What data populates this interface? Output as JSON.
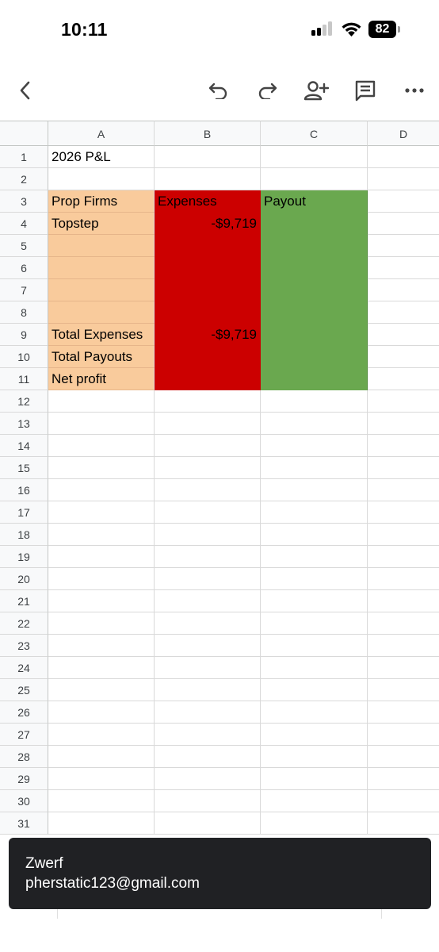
{
  "status_bar": {
    "time": "10:11",
    "battery": "82",
    "icons": [
      "cellular-signal-icon",
      "wifi-icon",
      "battery-icon"
    ]
  },
  "toolbar": {
    "icons": [
      "back-chevron-icon",
      "undo-icon",
      "redo-icon",
      "add-person-icon",
      "comment-icon",
      "more-icon"
    ]
  },
  "sheet": {
    "columns": [
      "A",
      "B",
      "C",
      "D"
    ],
    "rows": [
      {
        "n": "1",
        "a": "2026 P&L",
        "b": "",
        "c": ""
      },
      {
        "n": "2",
        "a": "",
        "b": "",
        "c": ""
      },
      {
        "n": "3",
        "a": "Prop Firms",
        "b": "Expenses",
        "c": "Payout"
      },
      {
        "n": "4",
        "a": "Topstep",
        "b": "-$9,719",
        "c": ""
      },
      {
        "n": "5",
        "a": "",
        "b": "",
        "c": ""
      },
      {
        "n": "6",
        "a": "",
        "b": "",
        "c": ""
      },
      {
        "n": "7",
        "a": "",
        "b": "",
        "c": ""
      },
      {
        "n": "8",
        "a": "",
        "b": "",
        "c": ""
      },
      {
        "n": "9",
        "a": "Total Expenses",
        "b": "-$9,719",
        "c": ""
      },
      {
        "n": "10",
        "a": "Total Payouts",
        "b": "",
        "c": ""
      },
      {
        "n": "11",
        "a": "Net profit",
        "b": "",
        "c": ""
      },
      {
        "n": "12",
        "a": "",
        "b": "",
        "c": ""
      },
      {
        "n": "13",
        "a": "",
        "b": "",
        "c": ""
      },
      {
        "n": "14",
        "a": "",
        "b": "",
        "c": ""
      },
      {
        "n": "15",
        "a": "",
        "b": "",
        "c": ""
      },
      {
        "n": "16",
        "a": "",
        "b": "",
        "c": ""
      },
      {
        "n": "17",
        "a": "",
        "b": "",
        "c": ""
      },
      {
        "n": "18",
        "a": "",
        "b": "",
        "c": ""
      },
      {
        "n": "19",
        "a": "",
        "b": "",
        "c": ""
      },
      {
        "n": "20",
        "a": "",
        "b": "",
        "c": ""
      },
      {
        "n": "21",
        "a": "",
        "b": "",
        "c": ""
      },
      {
        "n": "22",
        "a": "",
        "b": "",
        "c": ""
      },
      {
        "n": "23",
        "a": "",
        "b": "",
        "c": ""
      },
      {
        "n": "24",
        "a": "",
        "b": "",
        "c": ""
      },
      {
        "n": "25",
        "a": "",
        "b": "",
        "c": ""
      },
      {
        "n": "26",
        "a": "",
        "b": "",
        "c": ""
      },
      {
        "n": "27",
        "a": "",
        "b": "",
        "c": ""
      },
      {
        "n": "28",
        "a": "",
        "b": "",
        "c": ""
      },
      {
        "n": "29",
        "a": "",
        "b": "",
        "c": ""
      },
      {
        "n": "30",
        "a": "",
        "b": "",
        "c": ""
      },
      {
        "n": "31",
        "a": "",
        "b": "",
        "c": ""
      }
    ],
    "colors": {
      "col_a_fill": "#f9cb9c",
      "col_b_fill": "#cc0000",
      "col_c_fill": "#6aa84f"
    }
  },
  "toast": {
    "name": "Zwerf",
    "email": "pherstatic123@gmail.com"
  }
}
